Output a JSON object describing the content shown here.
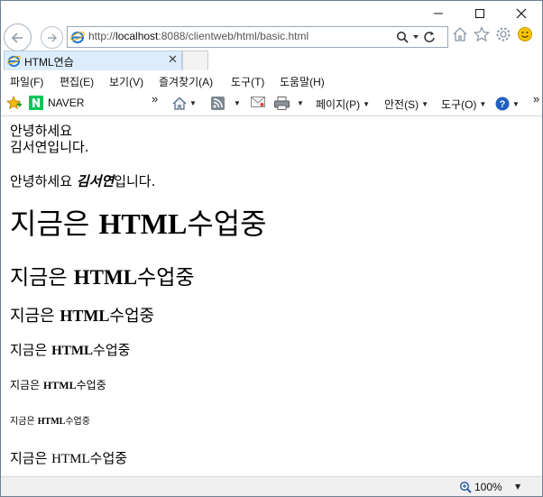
{
  "window": {
    "minimize_glyph": "—",
    "maximize_glyph": "☐",
    "close_glyph": "✕"
  },
  "address": {
    "url_host_prefix": "http://",
    "url_host": "localhost",
    "url_path": ":8088/clientweb/html/basic.html"
  },
  "tab": {
    "title": "HTML연습",
    "close_glyph": "✕"
  },
  "menu": {
    "items": [
      "파일(F)",
      "편집(E)",
      "보기(V)",
      "즐겨찾기(A)",
      "도구(T)",
      "도움말(H)"
    ]
  },
  "favorites": {
    "naver_label": "NAVER",
    "chevron": "»"
  },
  "commandbar": {
    "page_label": "페이지(P)",
    "safety_label": "안전(S)",
    "tools_label": "도구(O)",
    "chevron": "»"
  },
  "content": {
    "line1": "안녕하세요",
    "line2": "김서연입니다.",
    "para_prefix": "안녕하세요 ",
    "para_emph": "김서연",
    "para_suffix": "입니다.",
    "heading_prefix": "지금은 ",
    "heading_word": "HTML",
    "heading_suffix": "수업중"
  },
  "status": {
    "zoom": "100%"
  },
  "colors": {
    "ie_blue": "#1e73d2",
    "naver_green": "#03c75a",
    "star_yellow": "#f5b800",
    "help_blue": "#1f5fbf"
  }
}
